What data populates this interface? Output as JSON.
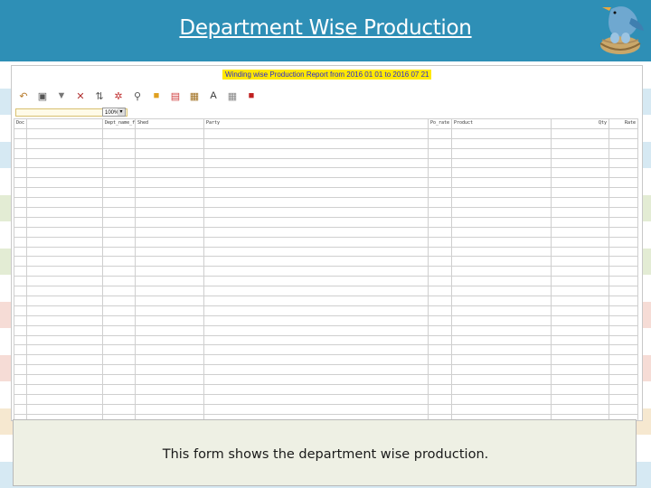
{
  "slide": {
    "title": "Department Wise Production",
    "caption": "This form shows the department wise production."
  },
  "colors": {
    "header": "#2e8fb6",
    "stripes": [
      "#ffffff",
      "#d6e9f3",
      "#ffffff",
      "#d6e9f3",
      "#ffffff",
      "#e3ecd4",
      "#ffffff",
      "#e3ecd4",
      "#ffffff",
      "#f6dcd6",
      "#ffffff",
      "#f6dcd6",
      "#ffffff",
      "#f6e8d0",
      "#ffffff",
      "#d6e9f3"
    ],
    "report_title_bg": "#ffe800",
    "report_title_text": "#2a2ad0"
  },
  "report": {
    "title": "Winding wise Production Report from 2016 01 01 to 2016 07 21",
    "zoom": "100%",
    "toolbar": [
      {
        "icon": "first-page-icon",
        "color": "#b77a2a",
        "glyph": "↶"
      },
      {
        "icon": "print-icon",
        "color": "#555555",
        "glyph": "▣"
      },
      {
        "icon": "filter-icon",
        "color": "#777777",
        "glyph": "▼"
      },
      {
        "icon": "clear-filter-icon",
        "color": "#b03030",
        "glyph": "✕"
      },
      {
        "icon": "sort-icon",
        "color": "#555555",
        "glyph": "⇅"
      },
      {
        "icon": "group-remove-icon",
        "color": "#c03030",
        "glyph": "✲"
      },
      {
        "icon": "search-icon",
        "color": "#555555",
        "glyph": "⚲"
      },
      {
        "icon": "export-icon",
        "color": "#e0a020",
        "glyph": "■"
      },
      {
        "icon": "export-data-icon",
        "color": "#d04040",
        "glyph": "▤"
      },
      {
        "icon": "table-icon",
        "color": "#a07020",
        "glyph": "▦"
      },
      {
        "icon": "text-icon",
        "color": "#333333",
        "glyph": "A"
      },
      {
        "icon": "grid-icon",
        "color": "#888888",
        "glyph": "▦"
      },
      {
        "icon": "close-report-icon",
        "color": "#c02020",
        "glyph": "■"
      }
    ],
    "columns": [
      "Doc Date",
      "",
      "Dept_name_fo",
      "Shed",
      "Party",
      "Po_rate",
      "Product",
      "Qty",
      "Rate"
    ]
  }
}
